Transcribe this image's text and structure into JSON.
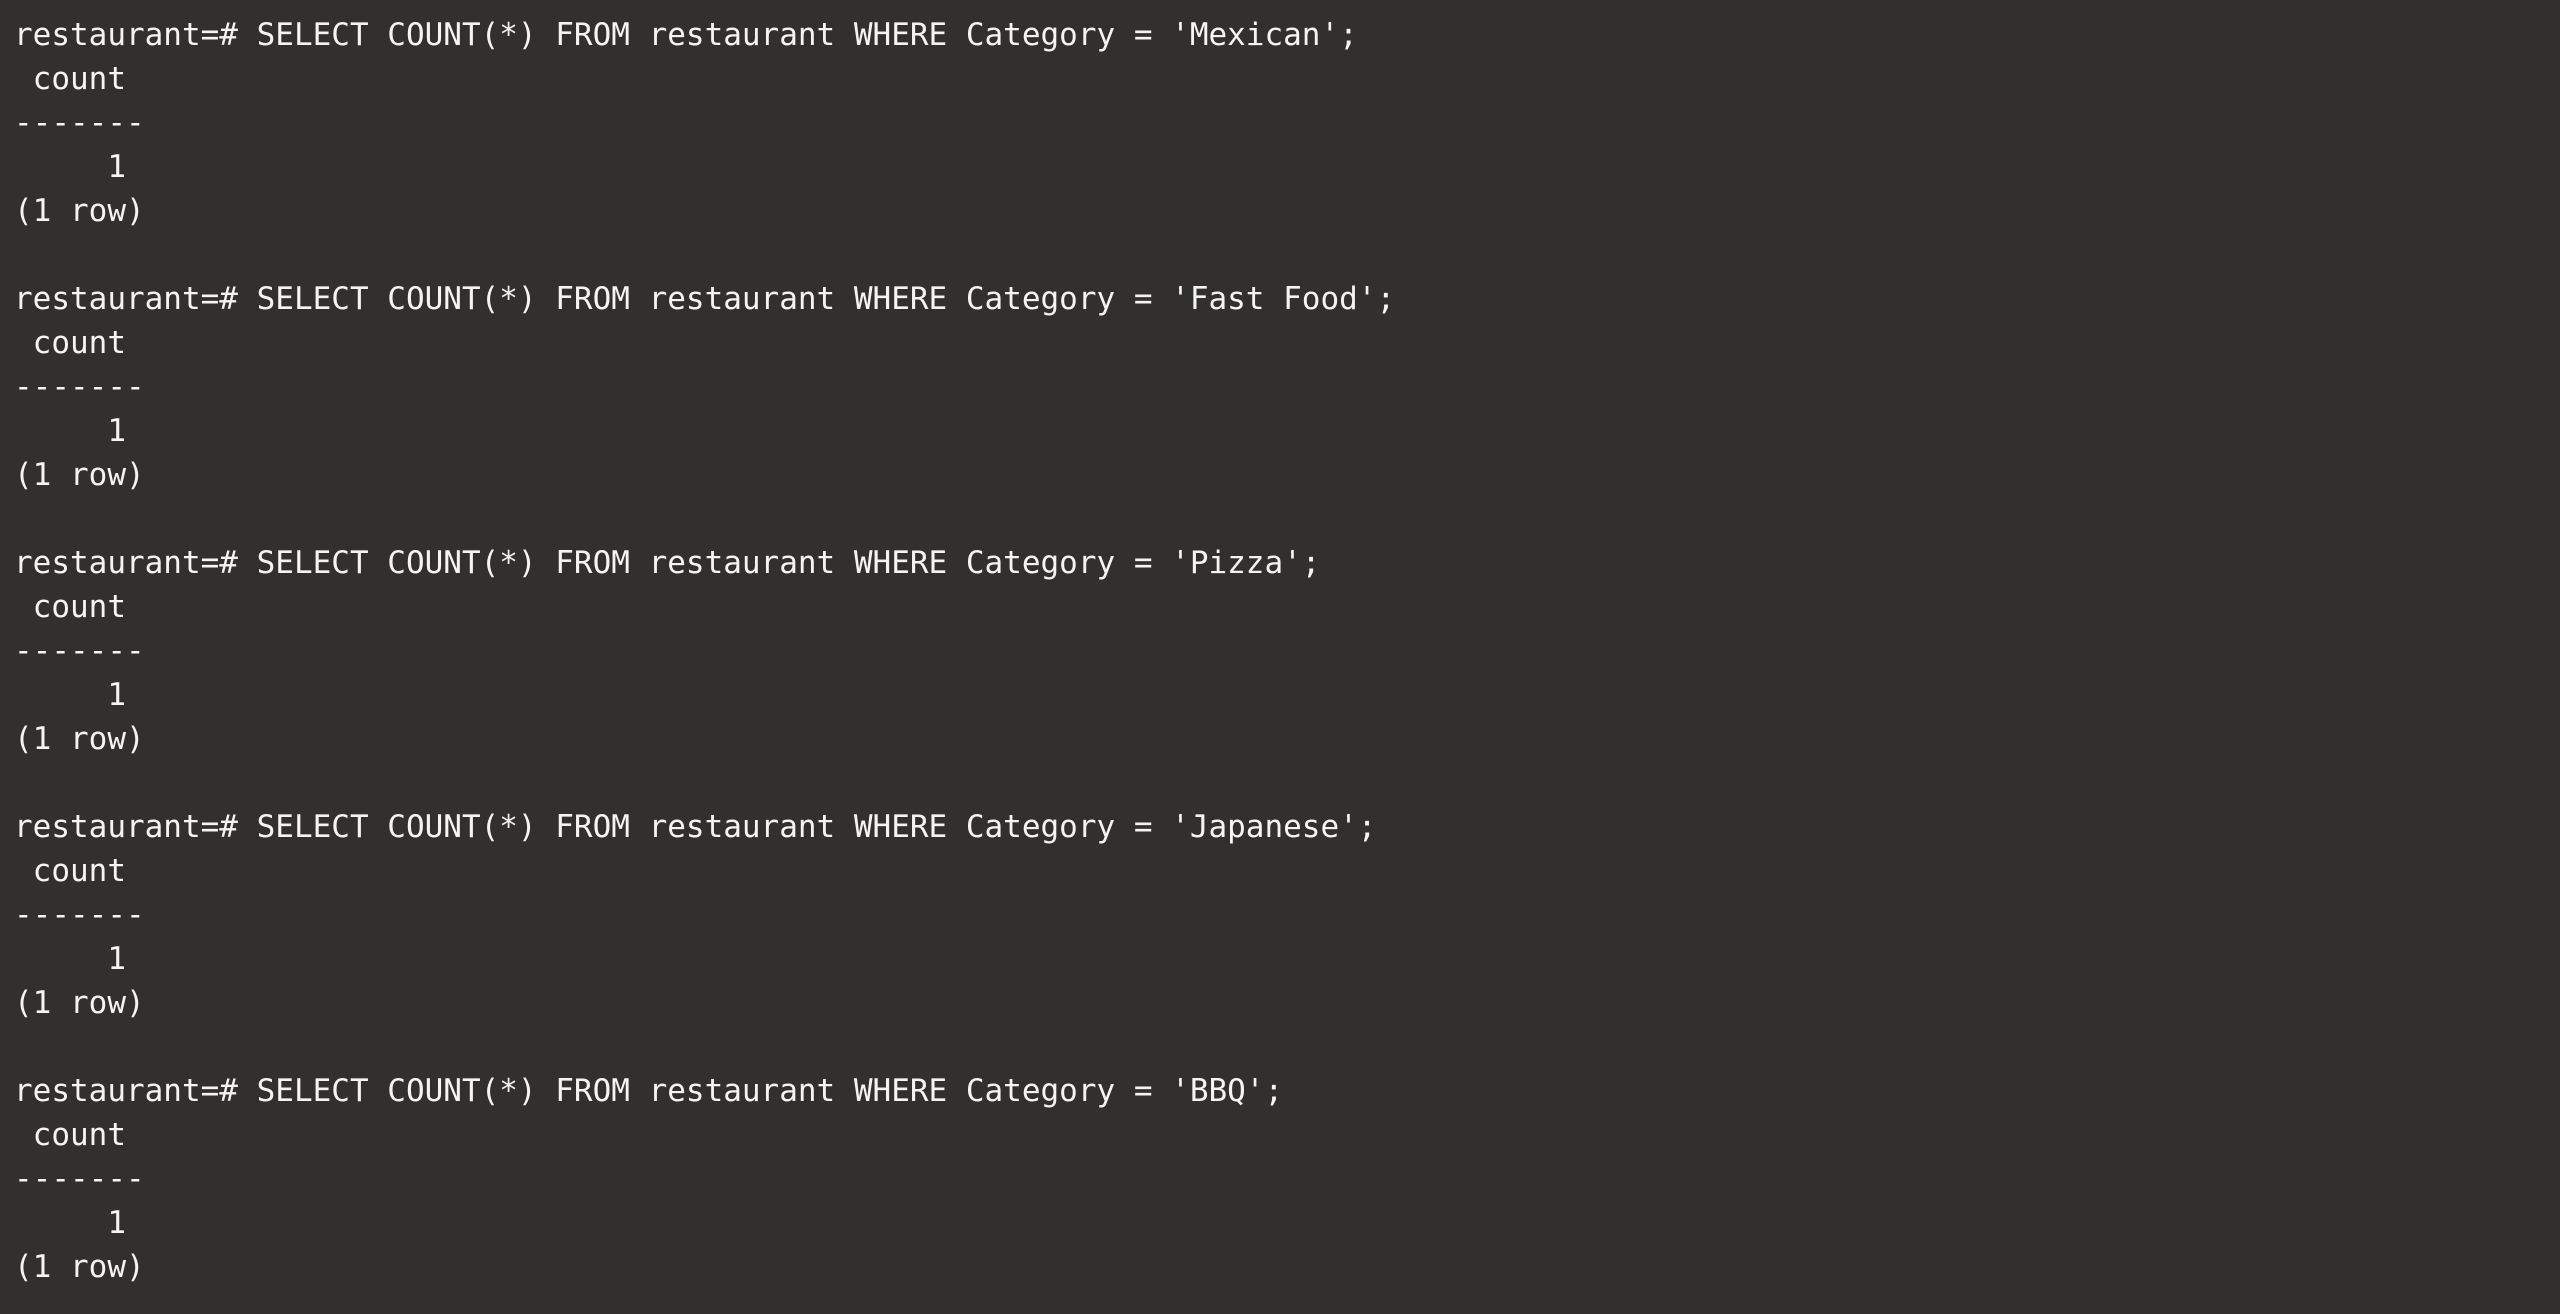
{
  "terminal": {
    "blocks": [
      {
        "prompt": "restaurant=#",
        "command": "SELECT COUNT(*) FROM restaurant WHERE Category = 'Mexican';",
        "header": " count",
        "separator": "-------",
        "value": "     1",
        "footer": "(1 row)"
      },
      {
        "prompt": "restaurant=#",
        "command": "SELECT COUNT(*) FROM restaurant WHERE Category = 'Fast Food';",
        "header": " count",
        "separator": "-------",
        "value": "     1",
        "footer": "(1 row)"
      },
      {
        "prompt": "restaurant=#",
        "command": "SELECT COUNT(*) FROM restaurant WHERE Category = 'Pizza';",
        "header": " count",
        "separator": "-------",
        "value": "     1",
        "footer": "(1 row)"
      },
      {
        "prompt": "restaurant=#",
        "command": "SELECT COUNT(*) FROM restaurant WHERE Category = 'Japanese';",
        "header": " count",
        "separator": "-------",
        "value": "     1",
        "footer": "(1 row)"
      },
      {
        "prompt": "restaurant=#",
        "command": "SELECT COUNT(*) FROM restaurant WHERE Category = 'BBQ';",
        "header": " count",
        "separator": "-------",
        "value": "     1",
        "footer": "(1 row)"
      }
    ]
  }
}
